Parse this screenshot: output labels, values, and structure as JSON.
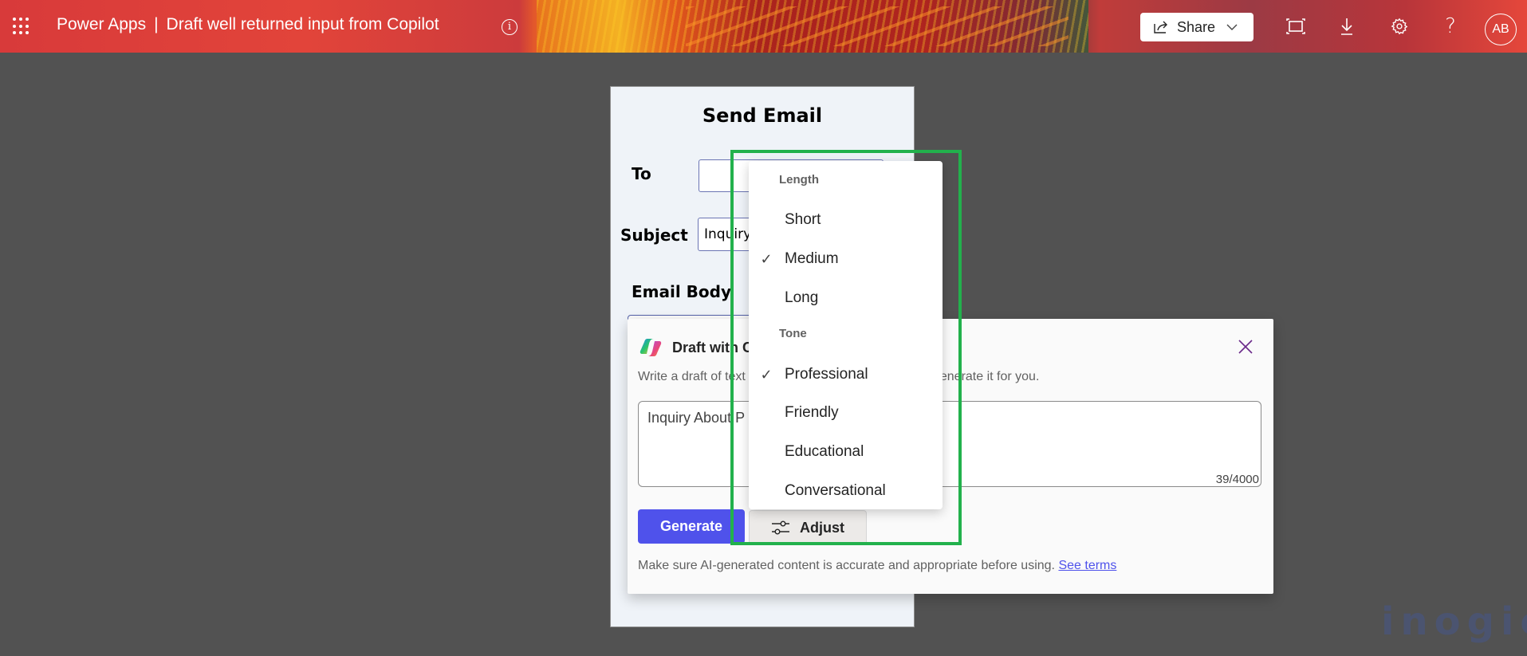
{
  "header": {
    "app_name": "Power Apps",
    "separator": "|",
    "app_title": "Draft well returned input from Copilot",
    "info_glyph": "i",
    "share_label": "Share",
    "avatar_initials": "AB",
    "icons": [
      "waffle-icon",
      "info-icon",
      "share-icon",
      "chevron-down-icon",
      "fit-screen-icon",
      "download-icon",
      "settings-icon",
      "help-icon"
    ]
  },
  "form": {
    "title": "Send Email",
    "to_label": "To",
    "to_value": "",
    "subject_label": "Subject",
    "subject_value": "Inquiry",
    "body_label": "Email Body"
  },
  "copilot": {
    "title": "Draft with Copilot",
    "title_visible": "Draft with C",
    "description": "Write a draft of text and Copilot will generate it for you.",
    "description_left": "Write a draft of text",
    "description_right": "enerate it for you.",
    "prompt_value": "Inquiry About P",
    "char_count": "39/4000",
    "generate_label": "Generate",
    "adjust_label": "Adjust",
    "disclaimer": "Make sure AI-generated content is accurate and appropriate before using.",
    "terms_link": "See terms",
    "accent_color": "#4f52eb"
  },
  "adjust_menu": {
    "length_header": "Length",
    "length_options": [
      {
        "label": "Short",
        "selected": false
      },
      {
        "label": "Medium",
        "selected": true
      },
      {
        "label": "Long",
        "selected": false
      }
    ],
    "tone_header": "Tone",
    "tone_options": [
      {
        "label": "Professional",
        "selected": true
      },
      {
        "label": "Friendly",
        "selected": false
      },
      {
        "label": "Educational",
        "selected": false
      },
      {
        "label": "Conversational",
        "selected": false
      }
    ],
    "check_glyph": "✓"
  },
  "annotation": {
    "highlight_color": "#22b14c"
  },
  "watermark": "inogic"
}
